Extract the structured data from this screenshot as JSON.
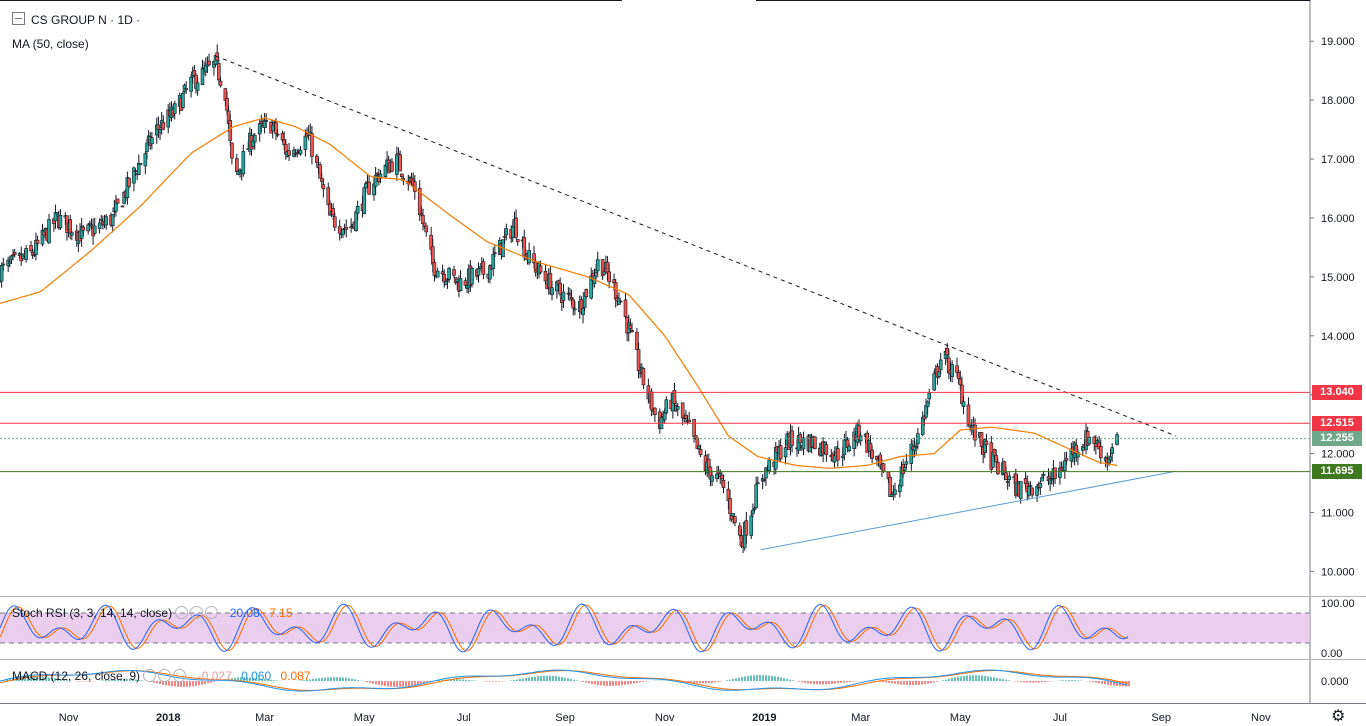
{
  "header": {
    "symbol_title": "CS GROUP N · 1D ·",
    "ma_legend": "MA (50, close)"
  },
  "stoch_legend": {
    "label": "Stoch RSI (3, 3, 14, 14, close)",
    "k": "20.08",
    "d": "7.15"
  },
  "macd_legend": {
    "label": "MACD (12, 26, close, 9)",
    "hist": "-0.027",
    "macd": "0.060",
    "signal": "0.087"
  },
  "price_tags": [
    {
      "text": "13.040",
      "price": 13.04,
      "color": "#f23645"
    },
    {
      "text": "12.515",
      "price": 12.515,
      "color": "#f23645"
    },
    {
      "text": "12.255",
      "price": 12.255,
      "color": "#6fa88a"
    },
    {
      "text": "11.695",
      "price": 11.695,
      "color": "#3d7a1f"
    }
  ],
  "price_axis_ticks": [
    "19.000",
    "18.000",
    "17.000",
    "16.000",
    "15.000",
    "14.000",
    "13.000",
    "12.000",
    "11.000",
    "10.000"
  ],
  "stoch_axis_ticks": [
    "100.00",
    "0.00"
  ],
  "macd_axis_ticks": [
    "0.000"
  ],
  "time_axis_ticks": [
    "Nov",
    "2018",
    "Mar",
    "May",
    "Jul",
    "Sep",
    "Nov",
    "2019",
    "Mar",
    "May",
    "Jul",
    "Sep",
    "Nov"
  ],
  "colors": {
    "up": "#26a69a",
    "down": "#ef5350",
    "ma": "#f57c00",
    "trend": "#5b9bd5",
    "resistance": "#d32f2f",
    "support": "#33691e",
    "stoch_band": "#e1bee7"
  },
  "chart_data": {
    "type": "candlestick",
    "title": "CS GROUP N · 1D",
    "indicators": [
      "MA (50, close)",
      "Stoch RSI (3, 3, 14, 14, close)",
      "MACD (12, 26, close, 9)"
    ],
    "ylim": [
      9.6,
      19.7
    ],
    "yticks": [
      10,
      11,
      12,
      13,
      14,
      15,
      16,
      17,
      18,
      19
    ],
    "x_ticks": [
      "Nov",
      "2018",
      "Mar",
      "May",
      "Jul",
      "Sep",
      "Nov",
      "2019",
      "Mar",
      "May",
      "Jul",
      "Sep",
      "Nov"
    ],
    "close_path": [
      [
        "2017-09-20",
        15.1
      ],
      [
        "2017-10-10",
        15.4
      ],
      [
        "2017-10-25",
        16.0
      ],
      [
        "2017-11-10",
        15.7
      ],
      [
        "2017-11-28",
        16.0
      ],
      [
        "2017-12-12",
        16.8
      ],
      [
        "2017-12-25",
        17.5
      ],
      [
        "2018-01-05",
        17.8
      ],
      [
        "2018-01-15",
        18.3
      ],
      [
        "2018-01-30",
        18.6
      ],
      [
        "2018-02-05",
        18.15
      ],
      [
        "2018-02-10",
        16.6
      ],
      [
        "2018-02-22",
        17.4
      ],
      [
        "2018-03-05",
        17.6
      ],
      [
        "2018-03-15",
        17.1
      ],
      [
        "2018-03-28",
        17.4
      ],
      [
        "2018-04-10",
        16.0
      ],
      [
        "2018-04-22",
        15.8
      ],
      [
        "2018-05-05",
        16.6
      ],
      [
        "2018-05-20",
        17.0
      ],
      [
        "2018-06-01",
        16.5
      ],
      [
        "2018-06-12",
        15.2
      ],
      [
        "2018-06-28",
        14.9
      ],
      [
        "2018-07-15",
        15.1
      ],
      [
        "2018-08-01",
        15.9
      ],
      [
        "2018-08-10",
        15.3
      ],
      [
        "2018-08-25",
        14.8
      ],
      [
        "2018-09-10",
        14.5
      ],
      [
        "2018-09-22",
        15.3
      ],
      [
        "2018-10-05",
        14.6
      ],
      [
        "2018-10-18",
        13.3
      ],
      [
        "2018-10-28",
        12.5
      ],
      [
        "2018-11-05",
        12.9
      ],
      [
        "2018-11-16",
        12.4
      ],
      [
        "2018-11-25",
        11.8
      ],
      [
        "2018-12-06",
        11.5
      ],
      [
        "2018-12-18",
        10.5
      ],
      [
        "2018-12-30",
        11.6
      ],
      [
        "2019-01-15",
        12.2
      ],
      [
        "2019-01-30",
        12.2
      ],
      [
        "2019-02-15",
        12.0
      ],
      [
        "2019-03-01",
        12.4
      ],
      [
        "2019-03-20",
        11.3
      ],
      [
        "2019-04-05",
        12.3
      ],
      [
        "2019-04-20",
        13.7
      ],
      [
        "2019-04-30",
        13.2
      ],
      [
        "2019-05-08",
        12.4
      ],
      [
        "2019-05-20",
        11.9
      ],
      [
        "2019-06-05",
        11.4
      ],
      [
        "2019-06-18",
        11.5
      ],
      [
        "2019-06-28",
        11.6
      ],
      [
        "2019-07-10",
        12.1
      ],
      [
        "2019-07-20",
        12.3
      ],
      [
        "2019-07-30",
        11.9
      ],
      [
        "2019-08-05",
        12.25
      ]
    ],
    "ma50_path": [
      [
        "2017-09-20",
        14.55
      ],
      [
        "2017-10-15",
        14.75
      ],
      [
        "2017-11-15",
        15.45
      ],
      [
        "2017-12-15",
        16.2
      ],
      [
        "2018-01-15",
        17.1
      ],
      [
        "2018-02-10",
        17.55
      ],
      [
        "2018-03-01",
        17.7
      ],
      [
        "2018-03-20",
        17.55
      ],
      [
        "2018-04-10",
        17.25
      ],
      [
        "2018-05-05",
        16.7
      ],
      [
        "2018-05-25",
        16.65
      ],
      [
        "2018-06-20",
        16.1
      ],
      [
        "2018-07-15",
        15.6
      ],
      [
        "2018-08-15",
        15.25
      ],
      [
        "2018-09-15",
        15.0
      ],
      [
        "2018-10-10",
        14.7
      ],
      [
        "2018-11-01",
        14.0
      ],
      [
        "2018-11-20",
        13.2
      ],
      [
        "2018-12-10",
        12.3
      ],
      [
        "2018-12-28",
        11.95
      ],
      [
        "2019-01-20",
        11.8
      ],
      [
        "2019-02-10",
        11.75
      ],
      [
        "2019-03-05",
        11.8
      ],
      [
        "2019-03-25",
        11.95
      ],
      [
        "2019-04-15",
        12.0
      ],
      [
        "2019-05-01",
        12.4
      ],
      [
        "2019-05-20",
        12.45
      ],
      [
        "2019-06-15",
        12.35
      ],
      [
        "2019-07-05",
        12.1
      ],
      [
        "2019-07-25",
        11.85
      ],
      [
        "2019-08-05",
        11.8
      ]
    ],
    "trendlines": [
      {
        "name": "resistance_trendline",
        "style": "dashed",
        "from": [
          "2018-01-30",
          18.75
        ],
        "to": [
          "2019-09-10",
          12.3
        ]
      },
      {
        "name": "support_trendline",
        "style": "solid",
        "from": [
          "2018-12-30",
          10.37
        ],
        "to": [
          "2019-09-10",
          11.7
        ]
      }
    ],
    "horizontal_levels": [
      13.04,
      12.515,
      11.695
    ],
    "last_close": 12.255,
    "stoch_rsi": {
      "k": 20.08,
      "d": 7.15,
      "upper_band": 80,
      "lower_band": 20,
      "ylim": [
        0,
        100
      ]
    },
    "macd": {
      "hist": -0.027,
      "macd": 0.06,
      "signal": 0.087
    }
  }
}
